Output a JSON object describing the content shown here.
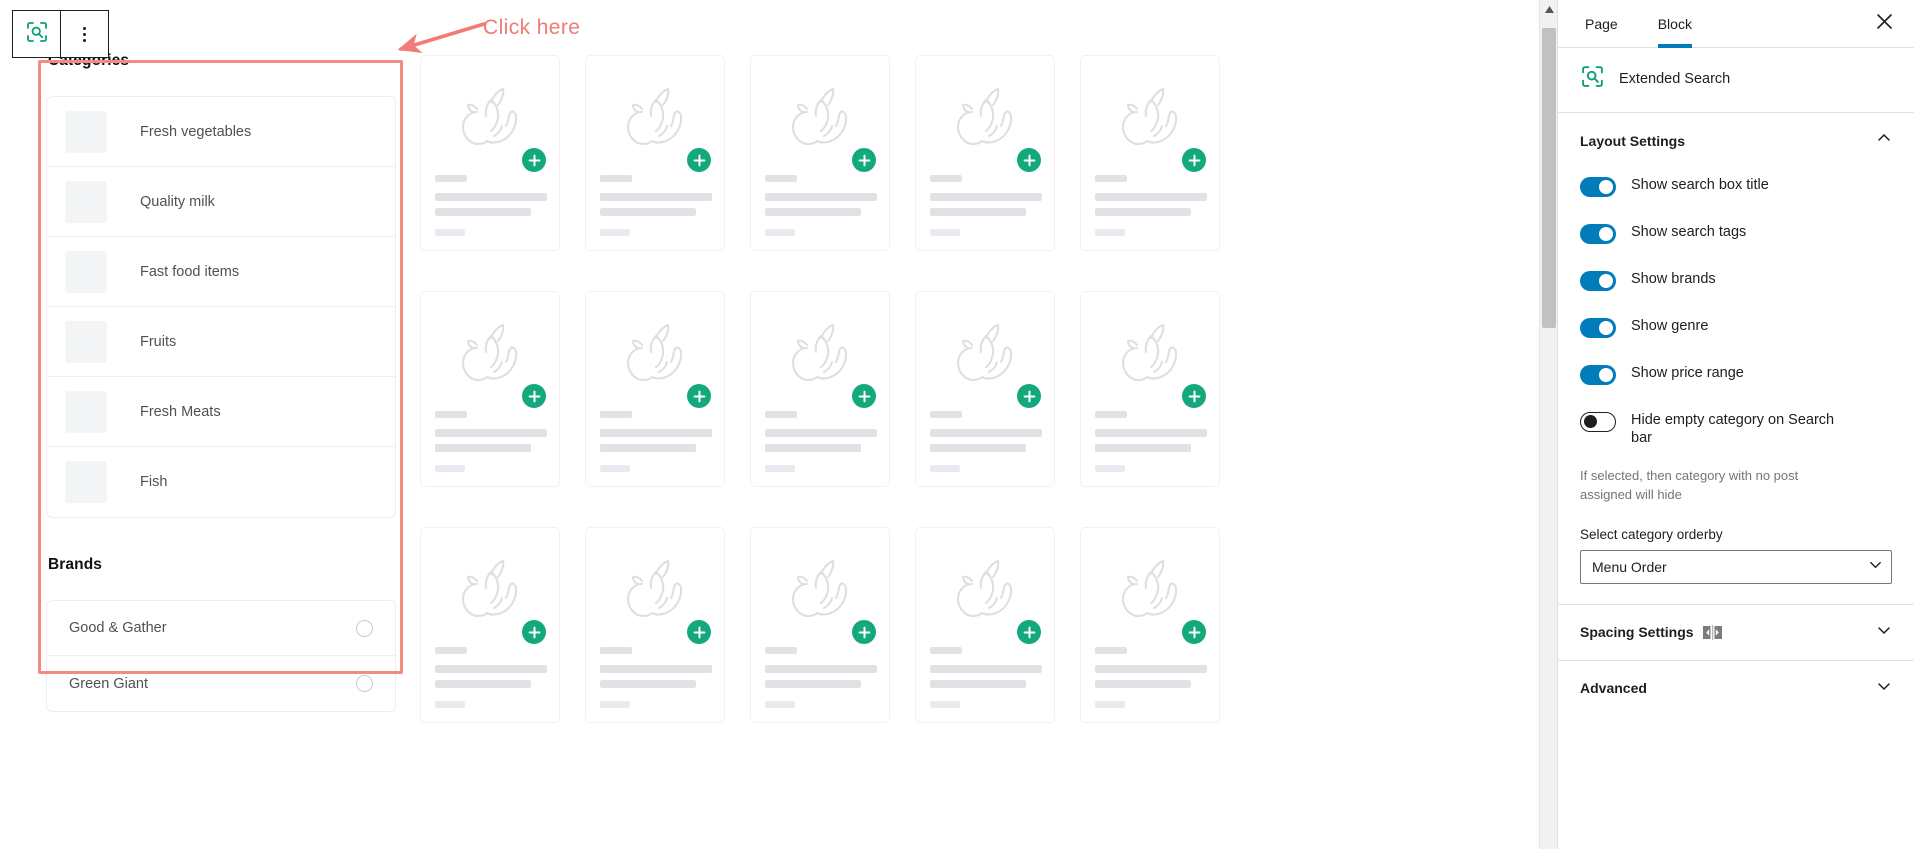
{
  "toolbar": {
    "block_icon": "extended-search-icon",
    "options_icon": "vertical-dots-icon"
  },
  "annotation": {
    "label": "Click here",
    "color": "#ef7b77"
  },
  "search_widget": {
    "categories_title": "Categories",
    "categories": [
      {
        "label": "Fresh vegetables"
      },
      {
        "label": "Quality milk"
      },
      {
        "label": "Fast food items"
      },
      {
        "label": "Fruits"
      },
      {
        "label": "Fresh Meats"
      },
      {
        "label": "Fish"
      }
    ],
    "brands_title": "Brands",
    "brands": [
      {
        "label": "Good & Gather"
      },
      {
        "label": "Green Giant"
      }
    ]
  },
  "product_grid": {
    "card_count": 15,
    "add_icon": "plus-icon",
    "art_icon": "fruits-placeholder-icon",
    "plus_color": "#14a97c"
  },
  "inspector": {
    "tabs": [
      {
        "label": "Page",
        "active": false
      },
      {
        "label": "Block",
        "active": true
      }
    ],
    "close_icon": "close-icon",
    "block_name": "Extended Search",
    "block_icon": "extended-search-icon",
    "accent_color": "#007cba",
    "layout_settings": {
      "title": "Layout Settings",
      "expanded": true,
      "chevron": "chevron-up-icon",
      "toggles": [
        {
          "label": "Show search box title",
          "on": true
        },
        {
          "label": "Show search tags",
          "on": true
        },
        {
          "label": "Show brands",
          "on": true
        },
        {
          "label": "Show genre",
          "on": true
        },
        {
          "label": "Show price range",
          "on": true
        },
        {
          "label": "Hide empty category on Search bar",
          "on": false
        }
      ],
      "help_text": "If selected, then category with no post assigned will hide",
      "orderby_label": "Select category orderby",
      "orderby_value": "Menu Order"
    },
    "spacing_settings": {
      "title": "Spacing Settings",
      "icon": "spacing-icon",
      "chevron": "chevron-down-icon"
    },
    "advanced": {
      "title": "Advanced",
      "chevron": "chevron-down-icon"
    }
  }
}
